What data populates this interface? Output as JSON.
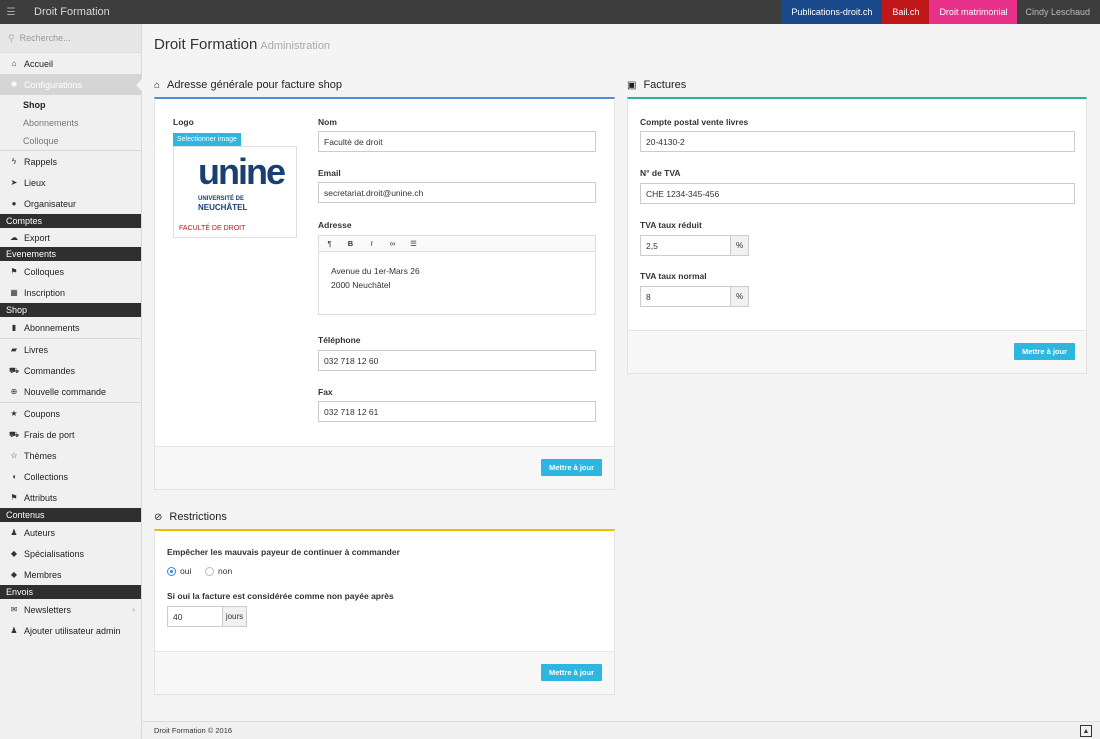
{
  "topbar": {
    "menu_icon": "hamburger-icon",
    "brand": "Droit Formation",
    "links": [
      "Publications-droit.ch",
      "Bail.ch",
      "Droit matrimonial"
    ],
    "link_colors": [
      "#1b4a8c",
      "#c0171b",
      "#e8318a"
    ],
    "user": "Cindy Leschaud"
  },
  "sidebar": {
    "search_placeholder": "Recherche...",
    "accueil": "Accueil",
    "configurations": "Configurations",
    "config_subs": [
      "Shop",
      "Abonnements",
      "Colloque"
    ],
    "rappels": "Rappels",
    "lieux": "Lieux",
    "organisateur": "Organisateur",
    "sections": [
      "Comptes",
      "Evenements",
      "Shop",
      "Contenus",
      "Envois"
    ],
    "export": "Export",
    "colloques": "Colloques",
    "inscription": "Inscription",
    "abonnements": "Abonnements",
    "livres": "Livres",
    "commandes": "Commandes",
    "nouvelle_commande": "Nouvelle commande",
    "coupons": "Coupons",
    "frais_de_port": "Frais de port",
    "themes": "Thèmes",
    "collections": "Collections",
    "attributs": "Attributs",
    "auteurs": "Auteurs",
    "specialisations": "Spécialisations",
    "membres": "Membres",
    "newsletters": "Newsletters",
    "ajouter_admin": "Ajouter utilisateur admin"
  },
  "page": {
    "title": "Droit Formation",
    "subtitle": "Administration"
  },
  "address_panel": {
    "title": "Adresse générale pour facture shop",
    "logo_label": "Logo",
    "select_image": "Selectionner image",
    "logo_text": "unine",
    "logo_line1": "UNIVERSITÉ DE",
    "logo_line2": "NEUCHÂTEL",
    "logo_line3": "FACULTÉ DE DROIT",
    "nom_label": "Nom",
    "nom_value": "Faculté de droit",
    "email_label": "Email",
    "email_value": "secretariat.droit@unine.ch",
    "adresse_label": "Adresse",
    "adresse_line1": "Avenue du 1er-Mars 26",
    "adresse_line2": "2000 Neuchâtel",
    "telephone_label": "Téléphone",
    "telephone_value": "032 718 12 60",
    "fax_label": "Fax",
    "fax_value": "032 718 12 61",
    "button": "Mettre à jour"
  },
  "factures_panel": {
    "title": "Factures",
    "compte_label": "Compte postal vente livres",
    "compte_value": "20-4130-2",
    "tva_label": "N° de TVA",
    "tva_value": "CHE 1234-345-456",
    "tva_reduit_label": "TVA taux réduit",
    "tva_reduit_value": "2,5",
    "tva_normal_label": "TVA taux normal",
    "tva_normal_value": "8",
    "percent": "%",
    "button": "Mettre à jour"
  },
  "restrictions_panel": {
    "title": "Restrictions",
    "question": "Empêcher les mauvais payeur de continuer à commander",
    "oui": "oui",
    "non": "non",
    "selected": "oui",
    "delay_label": "Si oui la facture est considérée comme non payée après",
    "days_value": "40",
    "days_unit": "jours",
    "button": "Mettre à jour"
  },
  "footer": {
    "text": "Droit Formation © 2016"
  }
}
